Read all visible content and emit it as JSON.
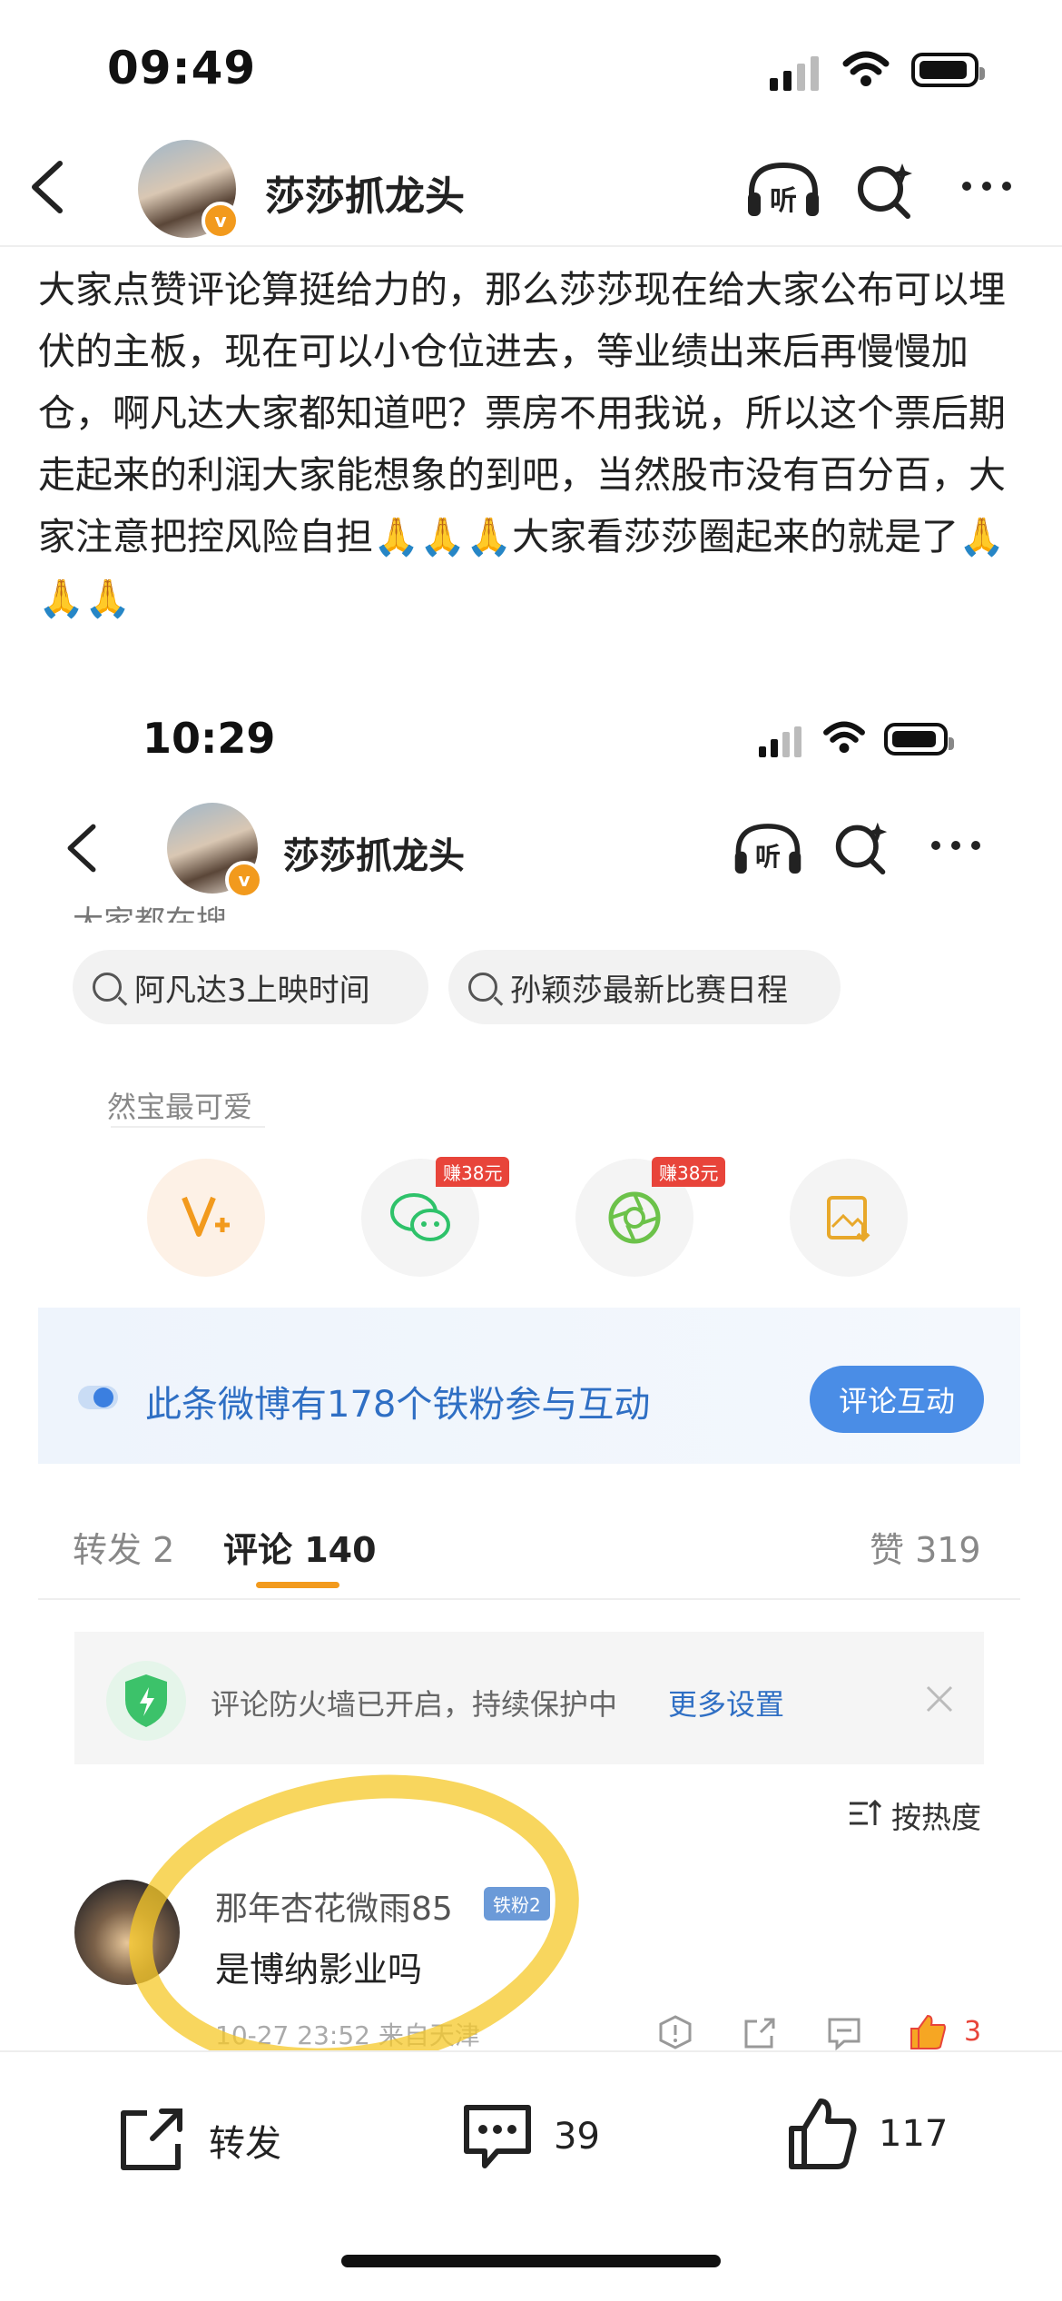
{
  "status_top": {
    "time": "09:49"
  },
  "header_top": {
    "username": "莎莎抓龙头",
    "back_icon": "back-arrow-icon",
    "listen_label": "听",
    "more_icon": "more-dots-icon"
  },
  "post": {
    "text": "大家点赞评论算挺给力的，那么莎莎现在给大家公布可以埋伏的主板，现在可以小仓位进去，等业绩出来后再慢慢加仓，啊凡达大家都知道吧？票房不用我说，所以这个票后期走起来的利润大家能想象的到吧，当然股市没有百分百，大家注意把控风险自担🙏🙏🙏大家看莎莎圈起来的就是了🙏🙏🙏"
  },
  "status_inner": {
    "time": "10:29"
  },
  "header_inner": {
    "username": "莎莎抓龙头",
    "listen_label": "听"
  },
  "search": {
    "label": "大家都在搜",
    "chips": [
      "阿凡达3上映时间",
      "孙颖莎最新比赛日程"
    ]
  },
  "share": {
    "tooltip": "然宝最可爱",
    "earn_badge_1": "赚38元",
    "earn_badge_2": "赚38元",
    "icons": [
      "v-plus-icon",
      "wechat-icon",
      "moments-icon",
      "save-image-icon"
    ]
  },
  "fans": {
    "text": "此条微博有178个铁粉参与互动",
    "button": "评论互动"
  },
  "tabs": {
    "repost": "转发 2",
    "comments": "评论 140",
    "likes": "赞 319"
  },
  "firewall": {
    "text": "评论防火墙已开启，持续保护中",
    "link": "更多设置"
  },
  "sort": {
    "label": "按热度"
  },
  "comment": {
    "name": "那年杏花微雨85",
    "badge": "铁粉2",
    "text": "是博纳影业吗",
    "meta": "10-27 23:52  来自天津",
    "likes": "3"
  },
  "bottom": {
    "repost": "转发",
    "comments": "39",
    "likes": "117"
  },
  "colors": {
    "accent": "#f29a1d",
    "link": "#2f6fc4",
    "like": "#e8443a",
    "highlight": "#f5c828"
  }
}
